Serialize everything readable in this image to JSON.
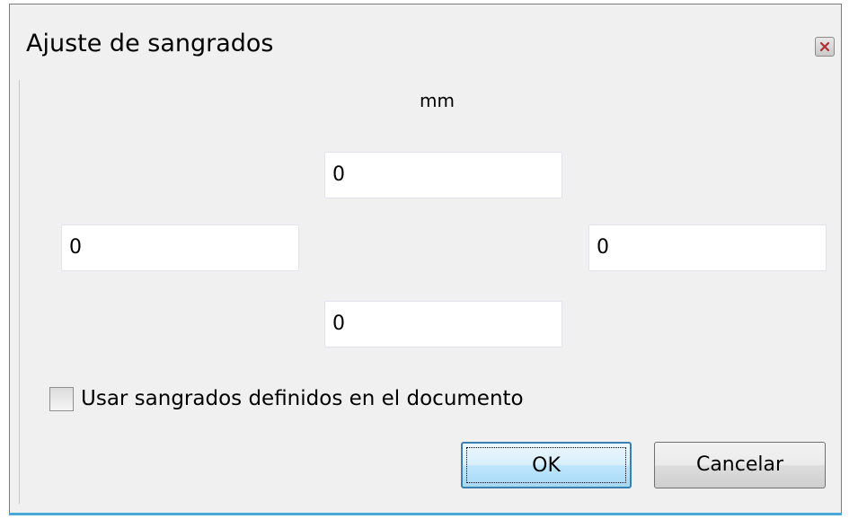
{
  "window": {
    "title": "Ajuste de sangrados"
  },
  "units": {
    "label": "mm"
  },
  "fields": {
    "top": "0",
    "left": "0",
    "right": "0",
    "bottom": "0"
  },
  "checkbox": {
    "label": "Usar sangrados definidos en el documento",
    "checked": false
  },
  "buttons": {
    "ok": "OK",
    "cancel": "Cancelar"
  },
  "icons": {
    "close": "close-icon"
  },
  "colors": {
    "background": "#f0f0f0",
    "ok_border": "#3c7fb1",
    "accent_line": "#4aa8d8"
  }
}
